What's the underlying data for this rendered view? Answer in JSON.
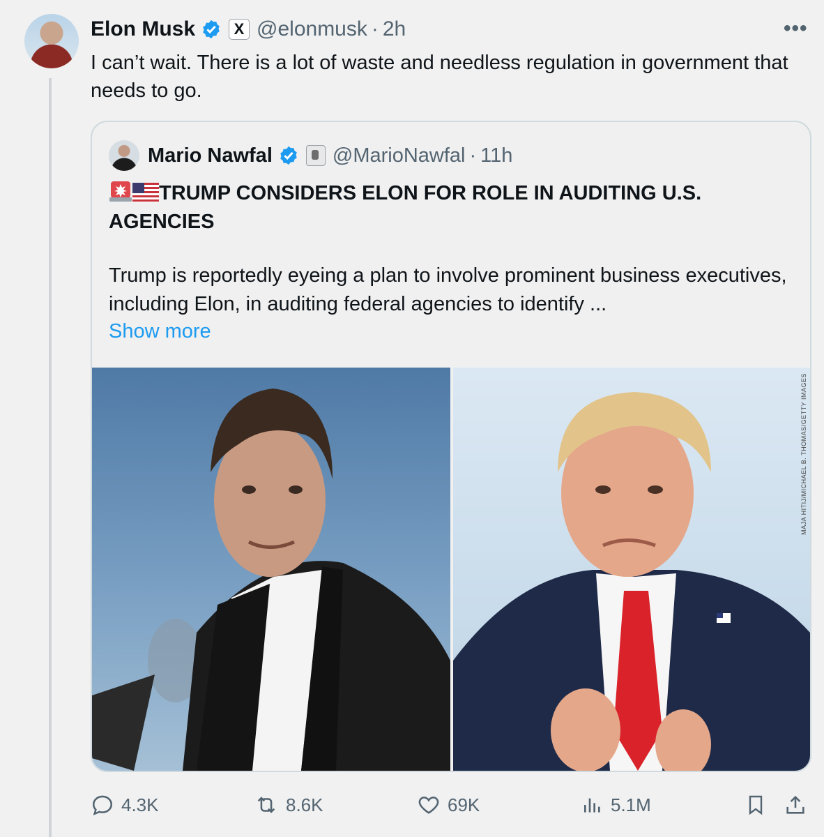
{
  "author": {
    "name": "Elon Musk",
    "handle": "@elonmusk",
    "separator": "·",
    "time": "2h",
    "affiliate_badge": "X"
  },
  "tweet": {
    "text": "I can’t wait. There is a lot of waste and needless regulation in government that needs to go."
  },
  "more_menu": "•••",
  "quote": {
    "name": "Mario Nawfal",
    "handle": "@MarioNawfal",
    "separator": "·",
    "time": "11h",
    "headline": "TRUMP CONSIDERS ELON FOR ROLE IN AUDITING U.S. AGENCIES",
    "body": "Trump is reportedly eyeing a plan to involve prominent business executives, including Elon, in auditing federal agencies to identify ...",
    "show_more": "Show more",
    "media_credit": "MAJA HITIJ/MICHAEL B. THOMAS/GETTY IMAGES",
    "emojis": [
      "siren-emoji",
      "us-flag-emoji"
    ]
  },
  "actions": {
    "replies": "4.3K",
    "reposts": "8.6K",
    "likes": "69K",
    "views": "5.1M"
  },
  "colors": {
    "accent": "#1d9bf0",
    "secondary_text": "#536471",
    "background": "#f1f1f1"
  }
}
